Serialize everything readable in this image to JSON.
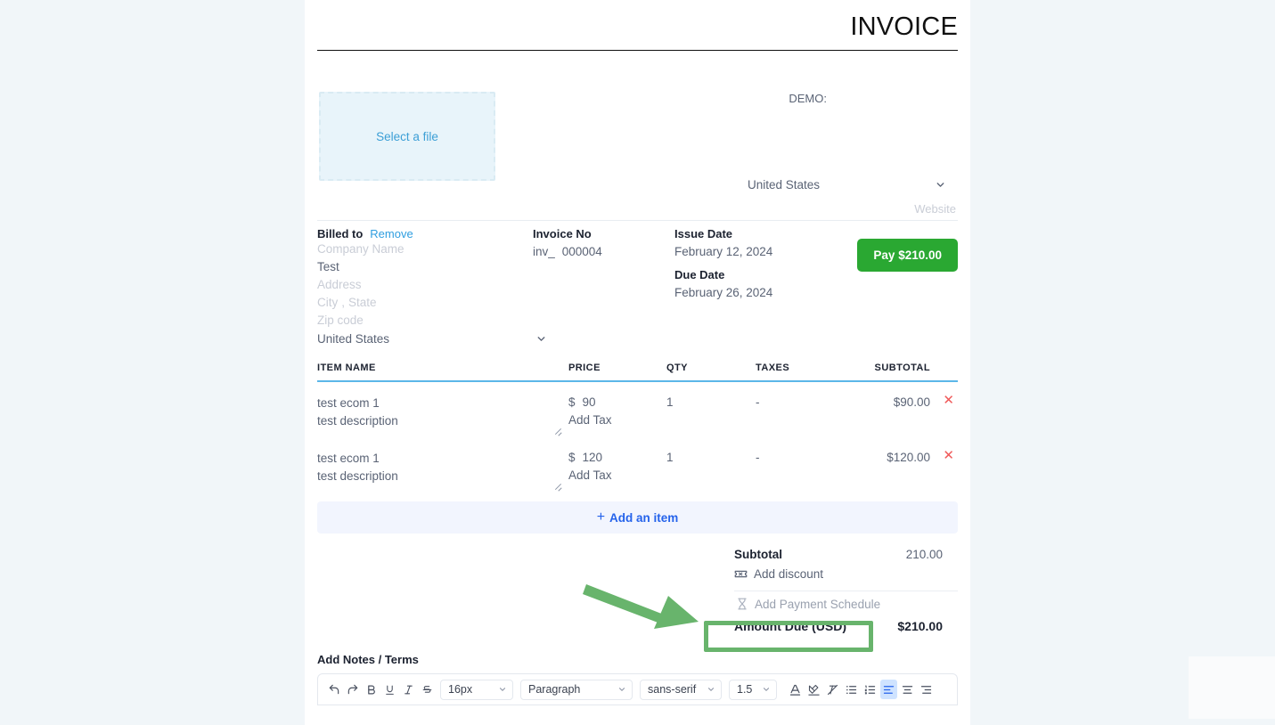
{
  "document": {
    "title": "INVOICE"
  },
  "header": {
    "logo_placeholder": "Select a file",
    "demo_label": "DEMO:",
    "country": "United States",
    "website_placeholder": "Website"
  },
  "billed_to": {
    "heading": "Billed to",
    "remove_label": "Remove",
    "company_placeholder": "Company Name",
    "contact_name": "Test",
    "address_placeholder": "Address",
    "city_placeholder": "City",
    "comma": ",",
    "state_placeholder": "State",
    "zip_placeholder": "Zip code",
    "country": "United States"
  },
  "meta": {
    "invoice_no_label": "Invoice No",
    "invoice_no_prefix": "inv_",
    "invoice_no_value": "000004",
    "issue_date_label": "Issue Date",
    "issue_date_value": "February 12, 2024",
    "due_date_label": "Due Date",
    "due_date_value": "February 26, 2024",
    "pay_button": "Pay $210.00"
  },
  "items_table": {
    "columns": [
      "ITEM NAME",
      "PRICE",
      "QTY",
      "TAXES",
      "SUBTOTAL"
    ],
    "rows": [
      {
        "name": "test ecom 1",
        "description": "test description",
        "currency": "$",
        "price": "90",
        "add_tax": "Add Tax",
        "qty": "1",
        "taxes": "-",
        "subtotal": "$90.00",
        "delete": "✕"
      },
      {
        "name": "test ecom 1",
        "description": "test description",
        "currency": "$",
        "price": "120",
        "add_tax": "Add Tax",
        "qty": "1",
        "taxes": "-",
        "subtotal": "$120.00",
        "delete": "✕"
      }
    ],
    "add_item_label": "Add an item",
    "add_item_plus": "+"
  },
  "totals": {
    "subtotal_label": "Subtotal",
    "subtotal_value": "210.00",
    "add_discount_label": "Add discount",
    "add_payment_schedule_label": "Add Payment Schedule",
    "amount_due_label": "Amount Due (USD)",
    "amount_due_value": "$210.00"
  },
  "notes": {
    "label": "Add Notes / Terms"
  },
  "editor_toolbar": {
    "font_size": "16px",
    "block_format": "Paragraph",
    "font_family": "sans-serif",
    "line_height": "1.5",
    "buttons": [
      "undo",
      "redo",
      "bold",
      "underline",
      "italic",
      "strikethrough",
      "text-color",
      "highlight-color",
      "clear-format",
      "bullet-list",
      "numbered-list",
      "align-left",
      "align-center",
      "align-right"
    ],
    "active_button": "align-left"
  },
  "annotation": {
    "arrow_color": "#68b46c",
    "highlight_color": "#68b46c",
    "target": "Add Payment Schedule"
  },
  "colors": {
    "page_background": "#f1f6f9",
    "card_background": "#ffffff",
    "accent_blue": "#2563eb",
    "link_blue": "#2f9ee0",
    "table_rule": "#5bb7e8",
    "pay_green": "#2aa832",
    "delete_red": "#f05a5a",
    "muted_text": "#5a6375",
    "placeholder_text": "#c9cdd6"
  }
}
